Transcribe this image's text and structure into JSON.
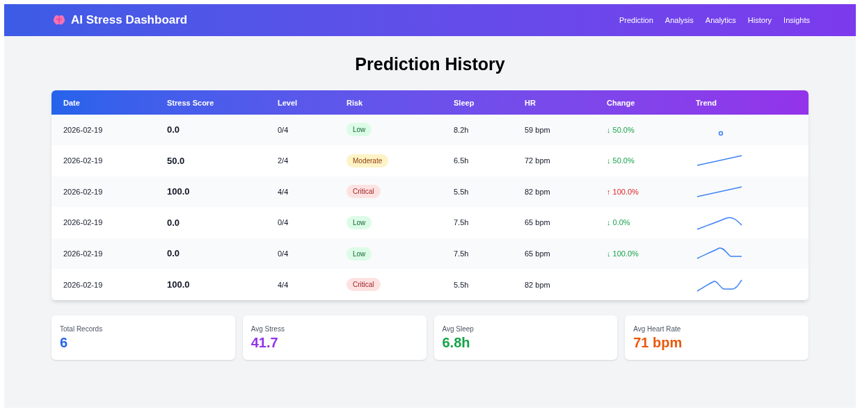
{
  "navbar": {
    "brand": "AI Stress Dashboard",
    "links": [
      "Prediction",
      "Analysis",
      "Analytics",
      "History",
      "Insights"
    ]
  },
  "page_title": "Prediction History",
  "table": {
    "columns": [
      "Date",
      "Stress Score",
      "Level",
      "Risk",
      "Sleep",
      "HR",
      "Change",
      "Trend"
    ],
    "rows": [
      {
        "date": "2026-02-19",
        "score": "0.0",
        "level": "0/4",
        "risk": {
          "label": "Low",
          "kind": "low"
        },
        "sleep": "8.2h",
        "hr": "59 bpm",
        "change": {
          "text": "↓ 50.0%",
          "kind": "down"
        },
        "trend": {
          "kind": "dot"
        }
      },
      {
        "date": "2026-02-19",
        "score": "50.0",
        "level": "2/4",
        "risk": {
          "label": "Moderate",
          "kind": "moderate"
        },
        "sleep": "6.5h",
        "hr": "72 bpm",
        "change": {
          "text": "↓ 50.0%",
          "kind": "down"
        },
        "trend": {
          "kind": "rise"
        }
      },
      {
        "date": "2026-02-19",
        "score": "100.0",
        "level": "4/4",
        "risk": {
          "label": "Critical",
          "kind": "critical"
        },
        "sleep": "5.5h",
        "hr": "82 bpm",
        "change": {
          "text": "↑ 100.0%",
          "kind": "up"
        },
        "trend": {
          "kind": "rise"
        }
      },
      {
        "date": "2026-02-19",
        "score": "0.0",
        "level": "0/4",
        "risk": {
          "label": "Low",
          "kind": "low"
        },
        "sleep": "7.5h",
        "hr": "65 bpm",
        "change": {
          "text": "↓ 0.0%",
          "kind": "down"
        },
        "trend": {
          "kind": "peak"
        }
      },
      {
        "date": "2026-02-19",
        "score": "0.0",
        "level": "0/4",
        "risk": {
          "label": "Low",
          "kind": "low"
        },
        "sleep": "7.5h",
        "hr": "65 bpm",
        "change": {
          "text": "↓ 100.0%",
          "kind": "down"
        },
        "trend": {
          "kind": "peak-flat"
        }
      },
      {
        "date": "2026-02-19",
        "score": "100.0",
        "level": "4/4",
        "risk": {
          "label": "Critical",
          "kind": "critical"
        },
        "sleep": "5.5h",
        "hr": "82 bpm",
        "trend": {
          "kind": "wave"
        }
      }
    ]
  },
  "stats": [
    {
      "label": "Total Records",
      "value": "6",
      "color": "#2563eb"
    },
    {
      "label": "Avg Stress",
      "value": "41.7",
      "color": "#9333ea"
    },
    {
      "label": "Avg Sleep",
      "value": "6.8h",
      "color": "#16a34a"
    },
    {
      "label": "Avg Heart Rate",
      "value": "71 bpm",
      "color": "#ea580c"
    }
  ]
}
